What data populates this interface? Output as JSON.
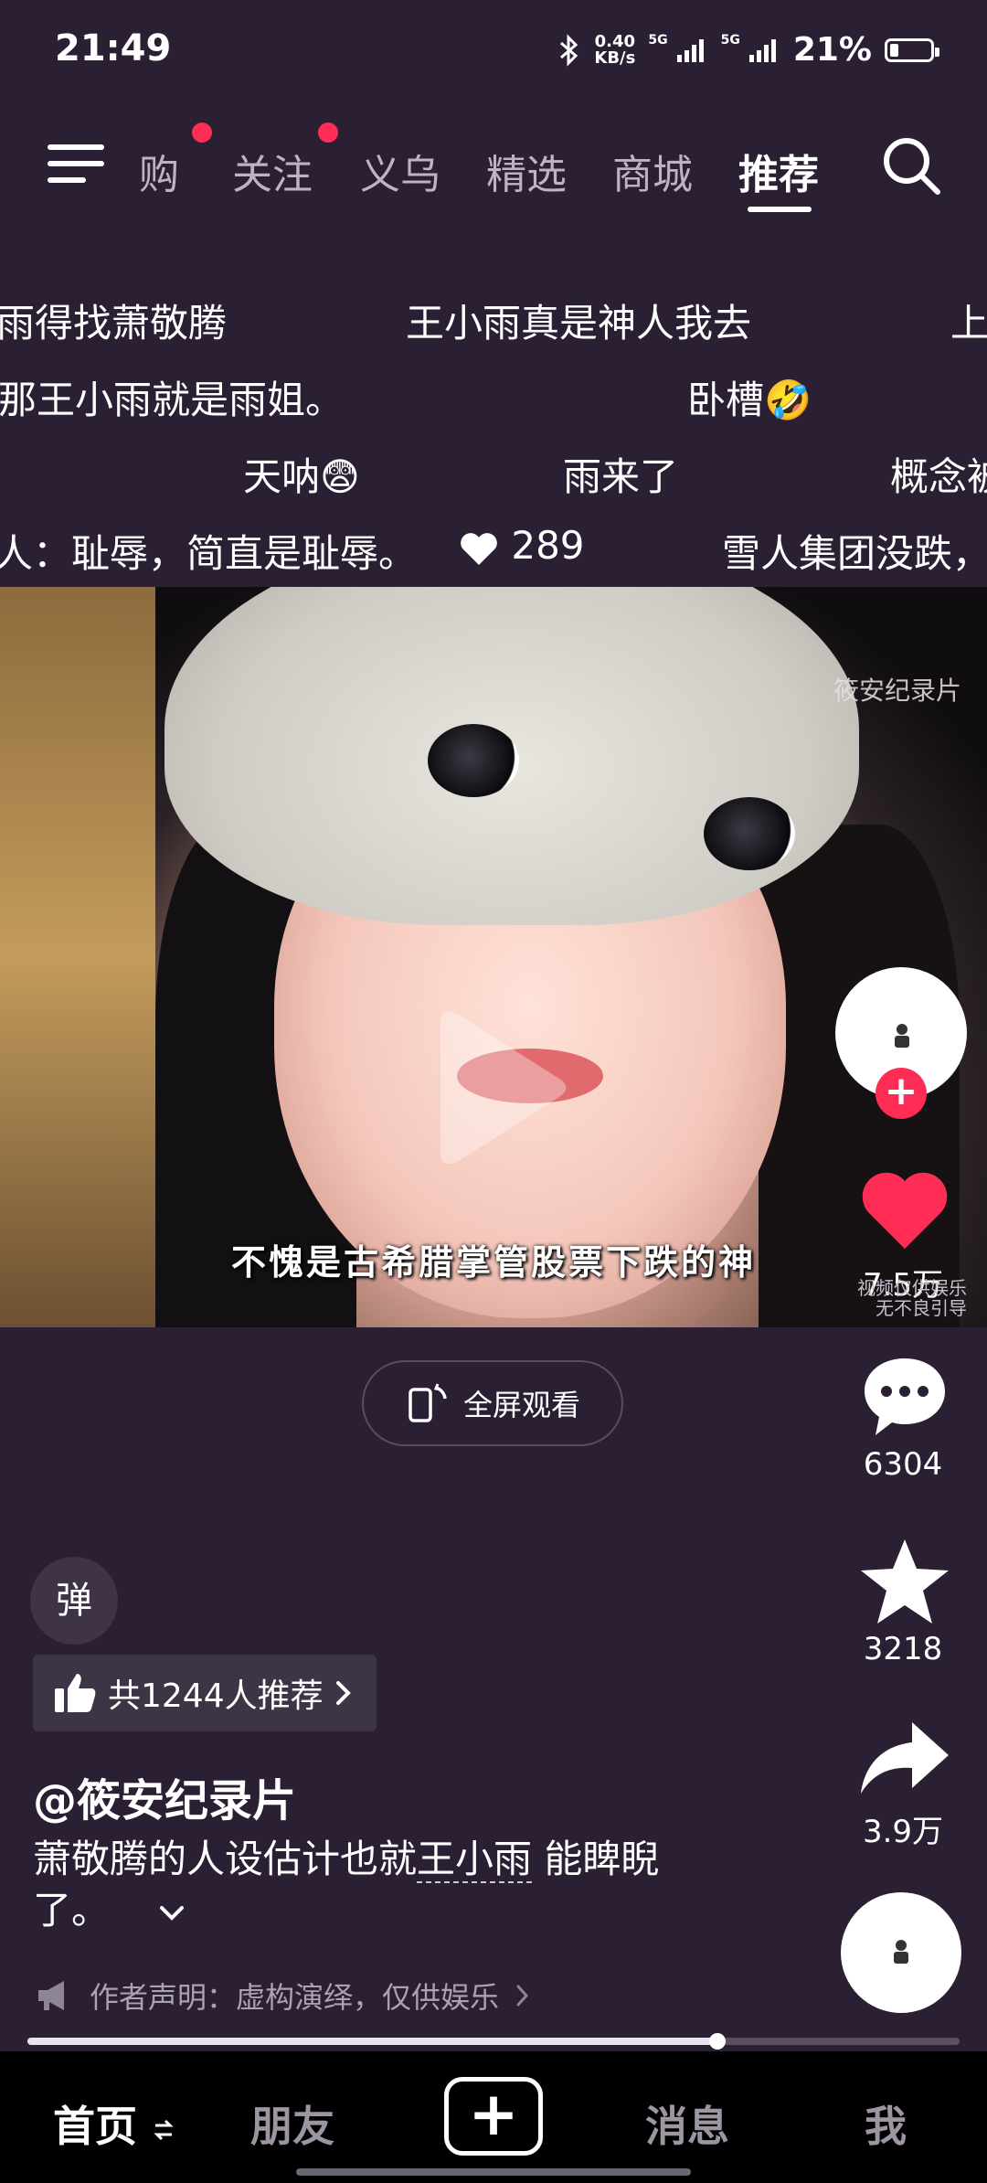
{
  "status_bar": {
    "time": "21:49",
    "net_speed_value": "0.40",
    "net_speed_unit": "KB/s",
    "signal_1": "5G",
    "signal_2": "5G",
    "battery_percent": "21%",
    "battery_level": 0.21
  },
  "top_nav": {
    "tabs": [
      "购",
      "关注",
      "义乌",
      "精选",
      "商城",
      "推荐"
    ],
    "active_tab": "推荐",
    "icons": {
      "menu": "menu-icon",
      "search": "search-icon"
    },
    "notification_dot_color": "#ff2d55"
  },
  "danmaku": [
    "雨得找萧敬腾",
    "王小雨真是神人我去",
    "上",
    "那王小雨就是雨姐。",
    "卧槽🤣",
    "天呐😨",
    "雨来了",
    "概念被",
    "人：耻辱，简直是耻辱。",
    "289",
    "雪人集团没跌，"
  ],
  "video": {
    "subtitle": "不愧是古希腊掌管股票下跌的神",
    "watermark": "筱安纪录片"
  },
  "fullscreen_button": {
    "label": "全屏观看",
    "icon": "fullscreen-phone-icon"
  },
  "right_rail": {
    "likes": "7.5万",
    "comments": "6304",
    "favorites": "3218",
    "shares": "3.9万",
    "side_note_line1": "视频仅供娱乐",
    "side_note_line2": "无不良引导",
    "like_color": "#ff2d55"
  },
  "info": {
    "danmaku_toggle": "弹",
    "recommend_label": "共1244人推荐",
    "author": "@筱安纪录片",
    "description_before": "萧敬腾的人设估计也就",
    "description_keyword": "王小雨",
    "description_after": " 能睥睨了。",
    "statement": "作者声明：虚构演绎，仅供娱乐"
  },
  "progress": {
    "fraction": 0.74
  },
  "tab_bar": {
    "home": "首页",
    "friends": "朋友",
    "messages": "消息",
    "me": "我"
  }
}
